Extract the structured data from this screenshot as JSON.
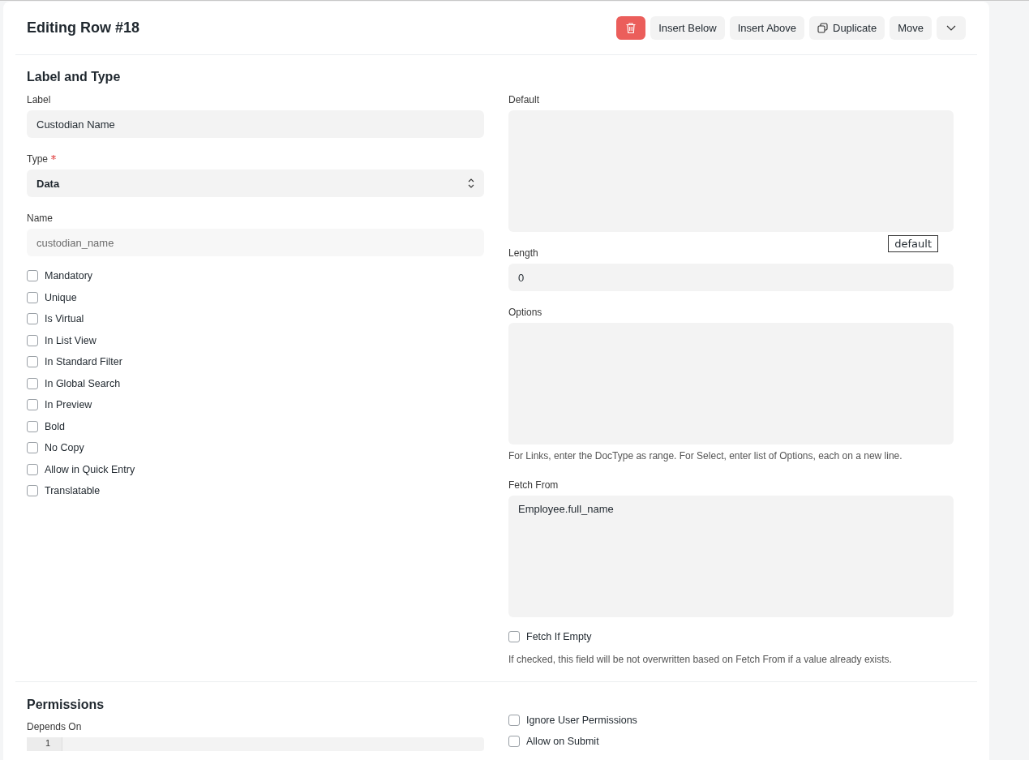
{
  "dialog": {
    "title": "Editing Row #18",
    "actions": [
      {
        "kind": "delete"
      },
      {
        "kind": "text",
        "label": "Insert Below"
      },
      {
        "kind": "text",
        "label": "Insert Above"
      },
      {
        "kind": "duplicate",
        "label": "Duplicate"
      },
      {
        "kind": "text",
        "label": "Move"
      },
      {
        "kind": "more"
      }
    ]
  },
  "label_and_type": {
    "title": "Label and Type",
    "label": {
      "label": "Label",
      "value": "Custodian Name"
    },
    "type": {
      "label": "Type",
      "required": true,
      "value": "Data"
    },
    "name": {
      "label": "Name",
      "value": "custodian_name"
    },
    "checkboxes": [
      {
        "label": "Mandatory",
        "checked": false
      },
      {
        "label": "Unique",
        "checked": false
      },
      {
        "label": "Is Virtual",
        "checked": false
      },
      {
        "label": "In List View",
        "checked": false
      },
      {
        "label": "In Standard Filter",
        "checked": false
      },
      {
        "label": "In Global Search",
        "checked": false
      },
      {
        "label": "In Preview",
        "checked": false
      },
      {
        "label": "Bold",
        "checked": false
      },
      {
        "label": "No Copy",
        "checked": false
      },
      {
        "label": "Allow in Quick Entry",
        "checked": false
      },
      {
        "label": "Translatable",
        "checked": false
      }
    ],
    "default": {
      "label": "Default",
      "tooltip": "default"
    },
    "length": {
      "label": "Length",
      "value": "0"
    },
    "options": {
      "label": "Options",
      "hint": "For Links, enter the DocType as range. For Select, enter list of Options, each on a new line."
    },
    "fetch_from": {
      "label": "Fetch From",
      "value": "Employee.full_name"
    },
    "fetch_if_empty": {
      "label": "Fetch If Empty",
      "checked": false,
      "hint": "If checked, this field will be not overwritten based on Fetch From if a value already exists."
    }
  },
  "permissions": {
    "title": "Permissions",
    "depends_on": {
      "label": "Depends On",
      "line_numbers": [
        "1"
      ]
    },
    "checkboxes": [
      {
        "label": "Ignore User Permissions",
        "checked": false
      },
      {
        "label": "Allow on Submit",
        "checked": false
      }
    ]
  }
}
